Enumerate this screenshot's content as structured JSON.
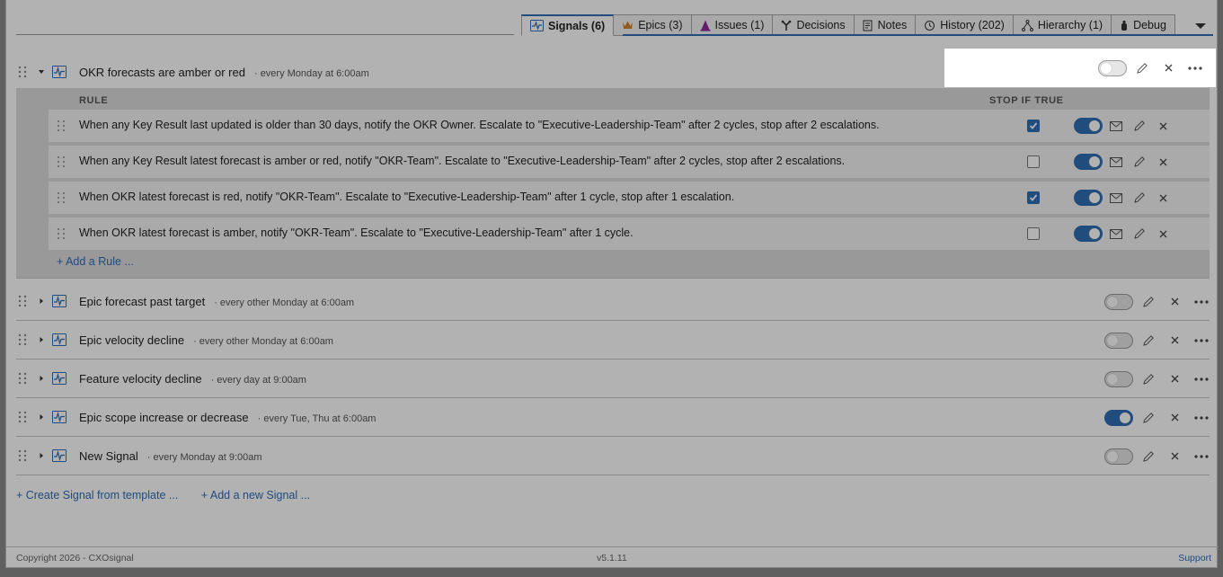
{
  "tabs": [
    {
      "label": "Signals (6)",
      "icon": "signal-icon",
      "color": "#2f6db5",
      "active": true
    },
    {
      "label": "Epics (3)",
      "icon": "crown-icon",
      "color": "#d9822b"
    },
    {
      "label": "Issues (1)",
      "icon": "cone-icon",
      "color": "#8e2a9b"
    },
    {
      "label": "Decisions",
      "icon": "decision-icon",
      "color": "#333333"
    },
    {
      "label": "Notes",
      "icon": "notes-icon",
      "color": "#333333"
    },
    {
      "label": "History (202)",
      "icon": "history-icon",
      "color": "#333333"
    },
    {
      "label": "Hierarchy (1)",
      "icon": "hierarchy-icon",
      "color": "#333333"
    },
    {
      "label": "Debug",
      "icon": "debug-icon",
      "color": "#333333"
    }
  ],
  "rules_header": {
    "rule": "RULE",
    "stop_if_true": "STOP IF TRUE"
  },
  "signals": [
    {
      "name": "OKR forecasts are amber or red",
      "schedule": "· every Monday at 6:00am",
      "enabled": false,
      "expanded": true,
      "rules": [
        {
          "text": "When any Key Result last updated is older than 30 days, notify the OKR Owner. Escalate to \"Executive-Leadership-Team\" after 2 cycles, stop after 2 escalations.",
          "stop_if_true": true,
          "enabled": true
        },
        {
          "text": "When any Key Result latest forecast is amber or red, notify \"OKR-Team\". Escalate to \"Executive-Leadership-Team\" after 2 cycles, stop after 2 escalations.",
          "stop_if_true": false,
          "enabled": true
        },
        {
          "text": "When OKR latest forecast is red, notify \"OKR-Team\". Escalate to \"Executive-Leadership-Team\" after 1 cycle, stop after 1 escalation.",
          "stop_if_true": true,
          "enabled": true
        },
        {
          "text": "When OKR latest forecast is amber, notify \"OKR-Team\". Escalate to \"Executive-Leadership-Team\" after 1 cycle.",
          "stop_if_true": false,
          "enabled": true
        }
      ],
      "add_rule_label": "+ Add a Rule ..."
    },
    {
      "name": "Epic forecast past target",
      "schedule": "· every other Monday at 6:00am",
      "enabled": false
    },
    {
      "name": "Epic velocity decline",
      "schedule": "· every other Monday at 6:00am",
      "enabled": false
    },
    {
      "name": "Feature velocity decline",
      "schedule": "· every day at 9:00am",
      "enabled": false
    },
    {
      "name": "Epic scope increase or decrease",
      "schedule": "· every Tue, Thu at 6:00am",
      "enabled": true
    },
    {
      "name": "New Signal",
      "schedule": "· every Monday at 9:00am",
      "enabled": false
    }
  ],
  "actions": {
    "create_from_template": "+ Create Signal from template ...",
    "add_new_signal": "+ Add a new Signal ..."
  },
  "footer": {
    "copyright": "Copyright 2026 - CXOsignal",
    "version": "v5.1.11",
    "support": "Support"
  },
  "colors": {
    "accent": "#2f6db5",
    "overlay": "rgba(0,0,0,0.30)"
  }
}
